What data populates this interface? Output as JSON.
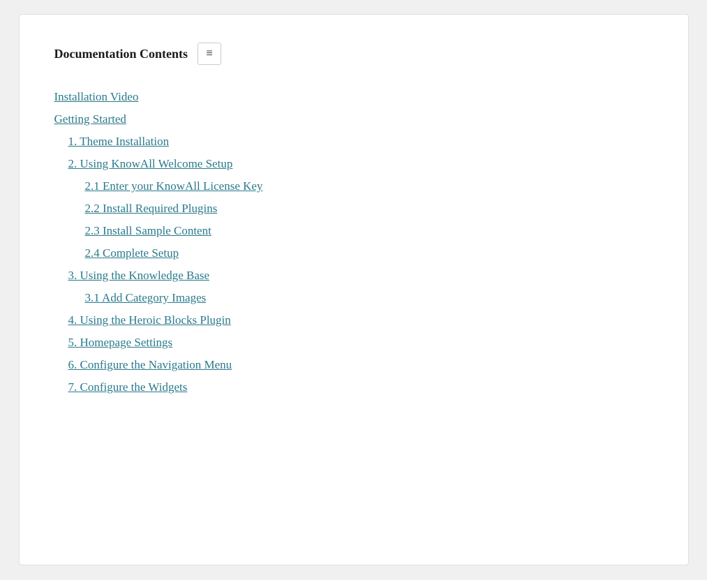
{
  "header": {
    "title": "Documentation Contents",
    "menu_icon": "≡"
  },
  "toc": {
    "items": [
      {
        "id": "installation-video",
        "label": "Installation Video",
        "level": "top-level"
      },
      {
        "id": "getting-started",
        "label": "Getting Started",
        "level": "top-level"
      },
      {
        "id": "theme-installation",
        "label": "1. Theme Installation",
        "level": "level-1"
      },
      {
        "id": "using-knowall-welcome-setup",
        "label": "2. Using KnowAll Welcome Setup",
        "level": "level-1"
      },
      {
        "id": "enter-license-key",
        "label": "2.1 Enter your KnowAll License Key",
        "level": "level-2"
      },
      {
        "id": "install-required-plugins",
        "label": "2.2 Install Required Plugins",
        "level": "level-2"
      },
      {
        "id": "install-sample-content",
        "label": "2.3 Install Sample Content",
        "level": "level-2"
      },
      {
        "id": "complete-setup",
        "label": "2.4 Complete Setup",
        "level": "level-2"
      },
      {
        "id": "using-knowledge-base",
        "label": "3. Using the Knowledge Base",
        "level": "level-1"
      },
      {
        "id": "add-category-images",
        "label": "3.1 Add Category Images",
        "level": "level-2"
      },
      {
        "id": "using-heroic-blocks",
        "label": "4. Using the Heroic Blocks Plugin",
        "level": "level-1"
      },
      {
        "id": "homepage-settings",
        "label": "5. Homepage Settings",
        "level": "level-1"
      },
      {
        "id": "configure-navigation-menu",
        "label": "6. Configure the Navigation Menu",
        "level": "level-1"
      },
      {
        "id": "configure-widgets",
        "label": "7. Configure the Widgets",
        "level": "level-1"
      }
    ]
  }
}
